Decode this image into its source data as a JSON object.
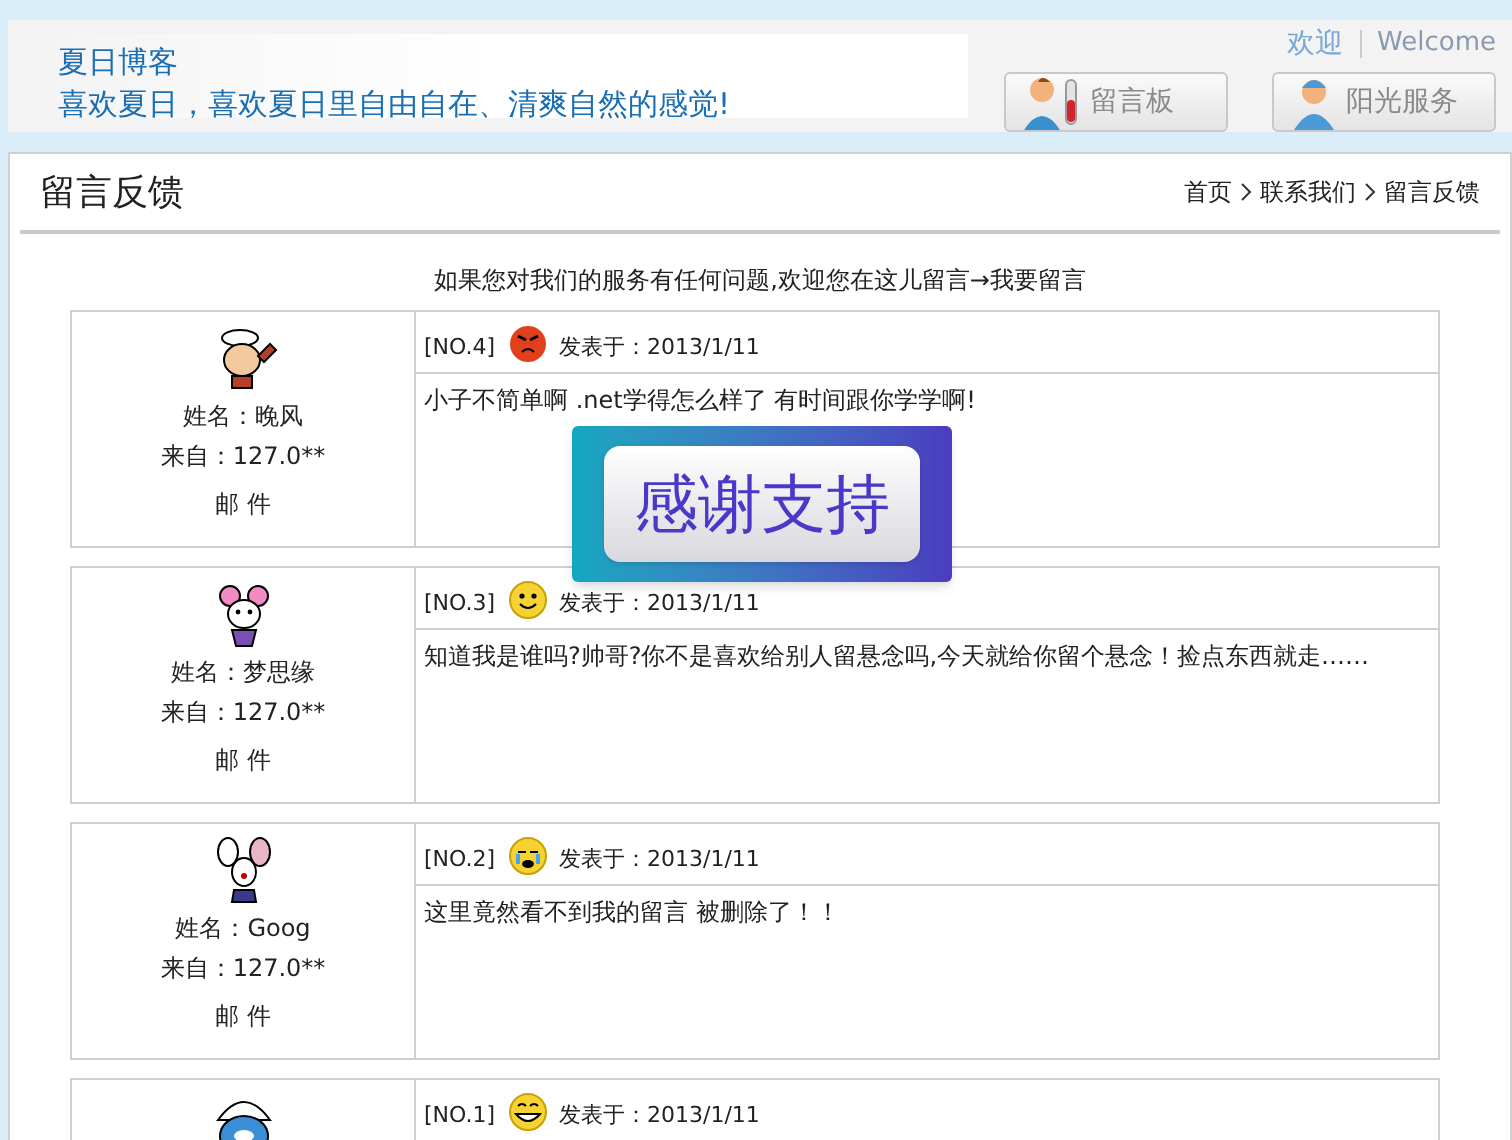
{
  "site": {
    "title": "夏日博客",
    "slogan": "喜欢夏日，喜欢夏日里自由自在、清爽自然的感觉!"
  },
  "top_links": [
    "欢迎",
    "Welcome"
  ],
  "nav_buttons": [
    {
      "label": "留言板",
      "kind": "lab"
    },
    {
      "label": "阳光服务",
      "kind": "doctor"
    }
  ],
  "page_title": "留言反馈",
  "breadcrumb": [
    "首页",
    "联系我们",
    "留言反馈"
  ],
  "intro": {
    "text": "如果您对我们的服务有任何问题,欢迎您在这儿留言→",
    "link": "我要留言"
  },
  "messages": [
    {
      "avatar": {
        "kind": "sailor"
      },
      "mood": {
        "kind": "angry"
      },
      "number": "[NO.4]",
      "posted": "发表于：2013/1/11",
      "name": "姓名：晚风",
      "from": "来自：127.0**",
      "mail": "邮 件",
      "body": "小子不简单啊 .net学得怎么样了 有时间跟你学学啊!"
    },
    {
      "avatar": {
        "kind": "girl"
      },
      "mood": {
        "kind": "smile"
      },
      "number": "[NO.3]",
      "posted": "发表于：2013/1/11",
      "name": "姓名：梦思缘",
      "from": "来自：127.0**",
      "mail": "邮 件",
      "body": "知道我是谁吗?帅哥?你不是喜欢给别人留悬念吗,今天就给你留个悬念！捡点东西就走……"
    },
    {
      "avatar": {
        "kind": "rabbit"
      },
      "mood": {
        "kind": "cry"
      },
      "number": "[NO.2]",
      "posted": "发表于：2013/1/11",
      "name": "姓名：Goog",
      "from": "来自：127.0**",
      "mail": "邮 件",
      "body": "这里竟然看不到我的留言 被删除了！！"
    },
    {
      "avatar": {
        "kind": "smurf"
      },
      "mood": {
        "kind": "grin"
      },
      "number": "[NO.1]",
      "posted": "发表于：2013/1/11"
    }
  ],
  "popup": "感谢支持"
}
